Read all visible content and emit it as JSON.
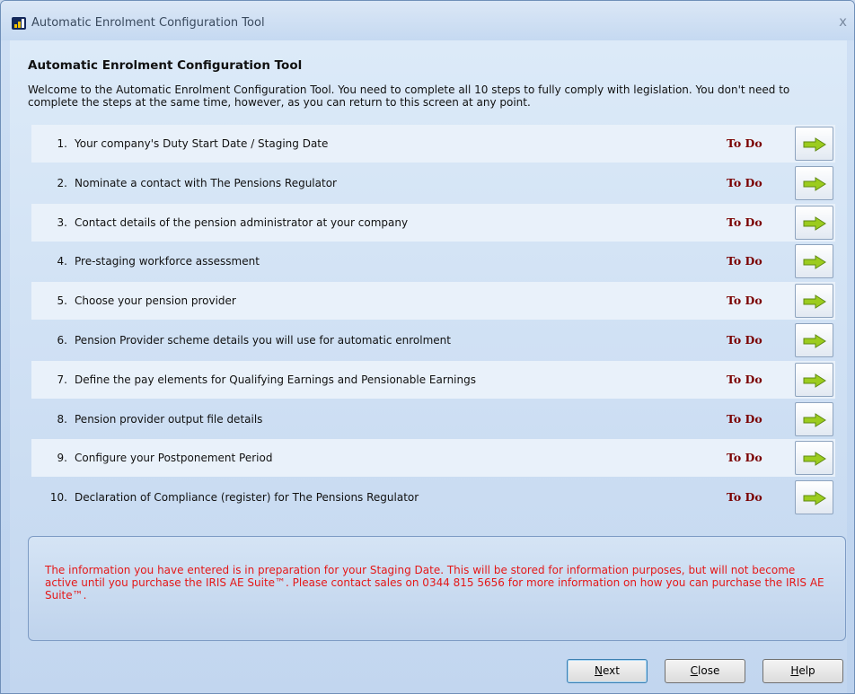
{
  "window": {
    "title": "Automatic Enrolment Configuration Tool",
    "close_glyph": "x"
  },
  "heading": "Automatic Enrolment Configuration Tool",
  "intro": "Welcome to the Automatic Enrolment Configuration Tool.  You need to complete all 10 steps to fully comply with legislation.  You don't need to complete the steps at the same time, however, as you can return to this screen at any point.",
  "steps": [
    {
      "num": "1.",
      "label": "Your company's Duty Start Date / Staging Date",
      "status": "To Do"
    },
    {
      "num": "2.",
      "label": "Nominate a contact with The Pensions Regulator",
      "status": "To Do"
    },
    {
      "num": "3.",
      "label": "Contact details of the pension administrator at your company",
      "status": "To Do"
    },
    {
      "num": "4.",
      "label": "Pre-staging workforce assessment",
      "status": "To Do"
    },
    {
      "num": "5.",
      "label": "Choose your pension provider",
      "status": "To Do"
    },
    {
      "num": "6.",
      "label": "Pension Provider scheme details you will use for automatic enrolment",
      "status": "To Do"
    },
    {
      "num": "7.",
      "label": "Define the pay elements for Qualifying Earnings and Pensionable Earnings",
      "status": "To Do"
    },
    {
      "num": "8.",
      "label": "Pension provider output file details",
      "status": "To Do"
    },
    {
      "num": "9.",
      "label": "Configure your Postponement Period",
      "status": "To Do"
    },
    {
      "num": "10.",
      "label": "Declaration of Compliance (register) for The Pensions Regulator",
      "status": "To Do"
    }
  ],
  "info": "The information you have entered is in preparation for your Staging Date.  This will be stored for information purposes, but will not become active until you purchase the IRIS AE Suite™.  Please contact sales on 0344 815 5656 for more information on how you can purchase the IRIS AE Suite™.",
  "buttons": {
    "next": {
      "first": "N",
      "rest": "ext"
    },
    "close": {
      "first": "C",
      "rest": "lose"
    },
    "help": {
      "first": "H",
      "rest": "elp"
    }
  },
  "colors": {
    "status": "#7a0000",
    "info_text": "#e41818",
    "arrow_fill": "#9ccc1e"
  },
  "icons": {
    "step_action": "green-right-arrow-icon",
    "app": "bar-chart-app-icon"
  }
}
